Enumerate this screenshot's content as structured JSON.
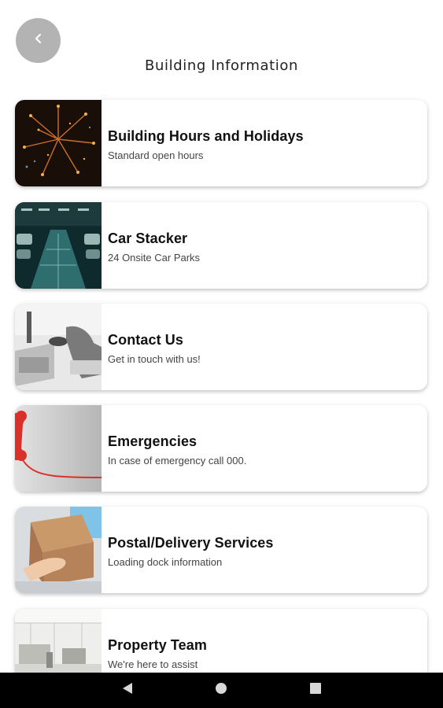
{
  "header": {
    "title": "Building Information",
    "back_icon": "chevron-left-icon"
  },
  "items": [
    {
      "title": "Building Hours and Holidays",
      "subtitle": "Standard open hours",
      "image": "fireworks-photo"
    },
    {
      "title": "Car Stacker",
      "subtitle": "24 Onsite Car Parks",
      "image": "car-park-photo"
    },
    {
      "title": "Contact Us",
      "subtitle": "Get in touch with us!",
      "image": "desk-phone-photo"
    },
    {
      "title": "Emergencies",
      "subtitle": "In case of emergency call 000.",
      "image": "red-phone-photo"
    },
    {
      "title": "Postal/Delivery Services",
      "subtitle": "Loading dock information",
      "image": "parcel-photo"
    },
    {
      "title": "Property Team",
      "subtitle": "We're here to assist",
      "image": "office-photo"
    }
  ],
  "navbar": {
    "back_icon": "triangle-back-icon",
    "home_icon": "circle-home-icon",
    "recents_icon": "square-recents-icon"
  },
  "colors": {
    "back_button_bg": "#b3b3b3",
    "navbar_bg": "#000000"
  }
}
